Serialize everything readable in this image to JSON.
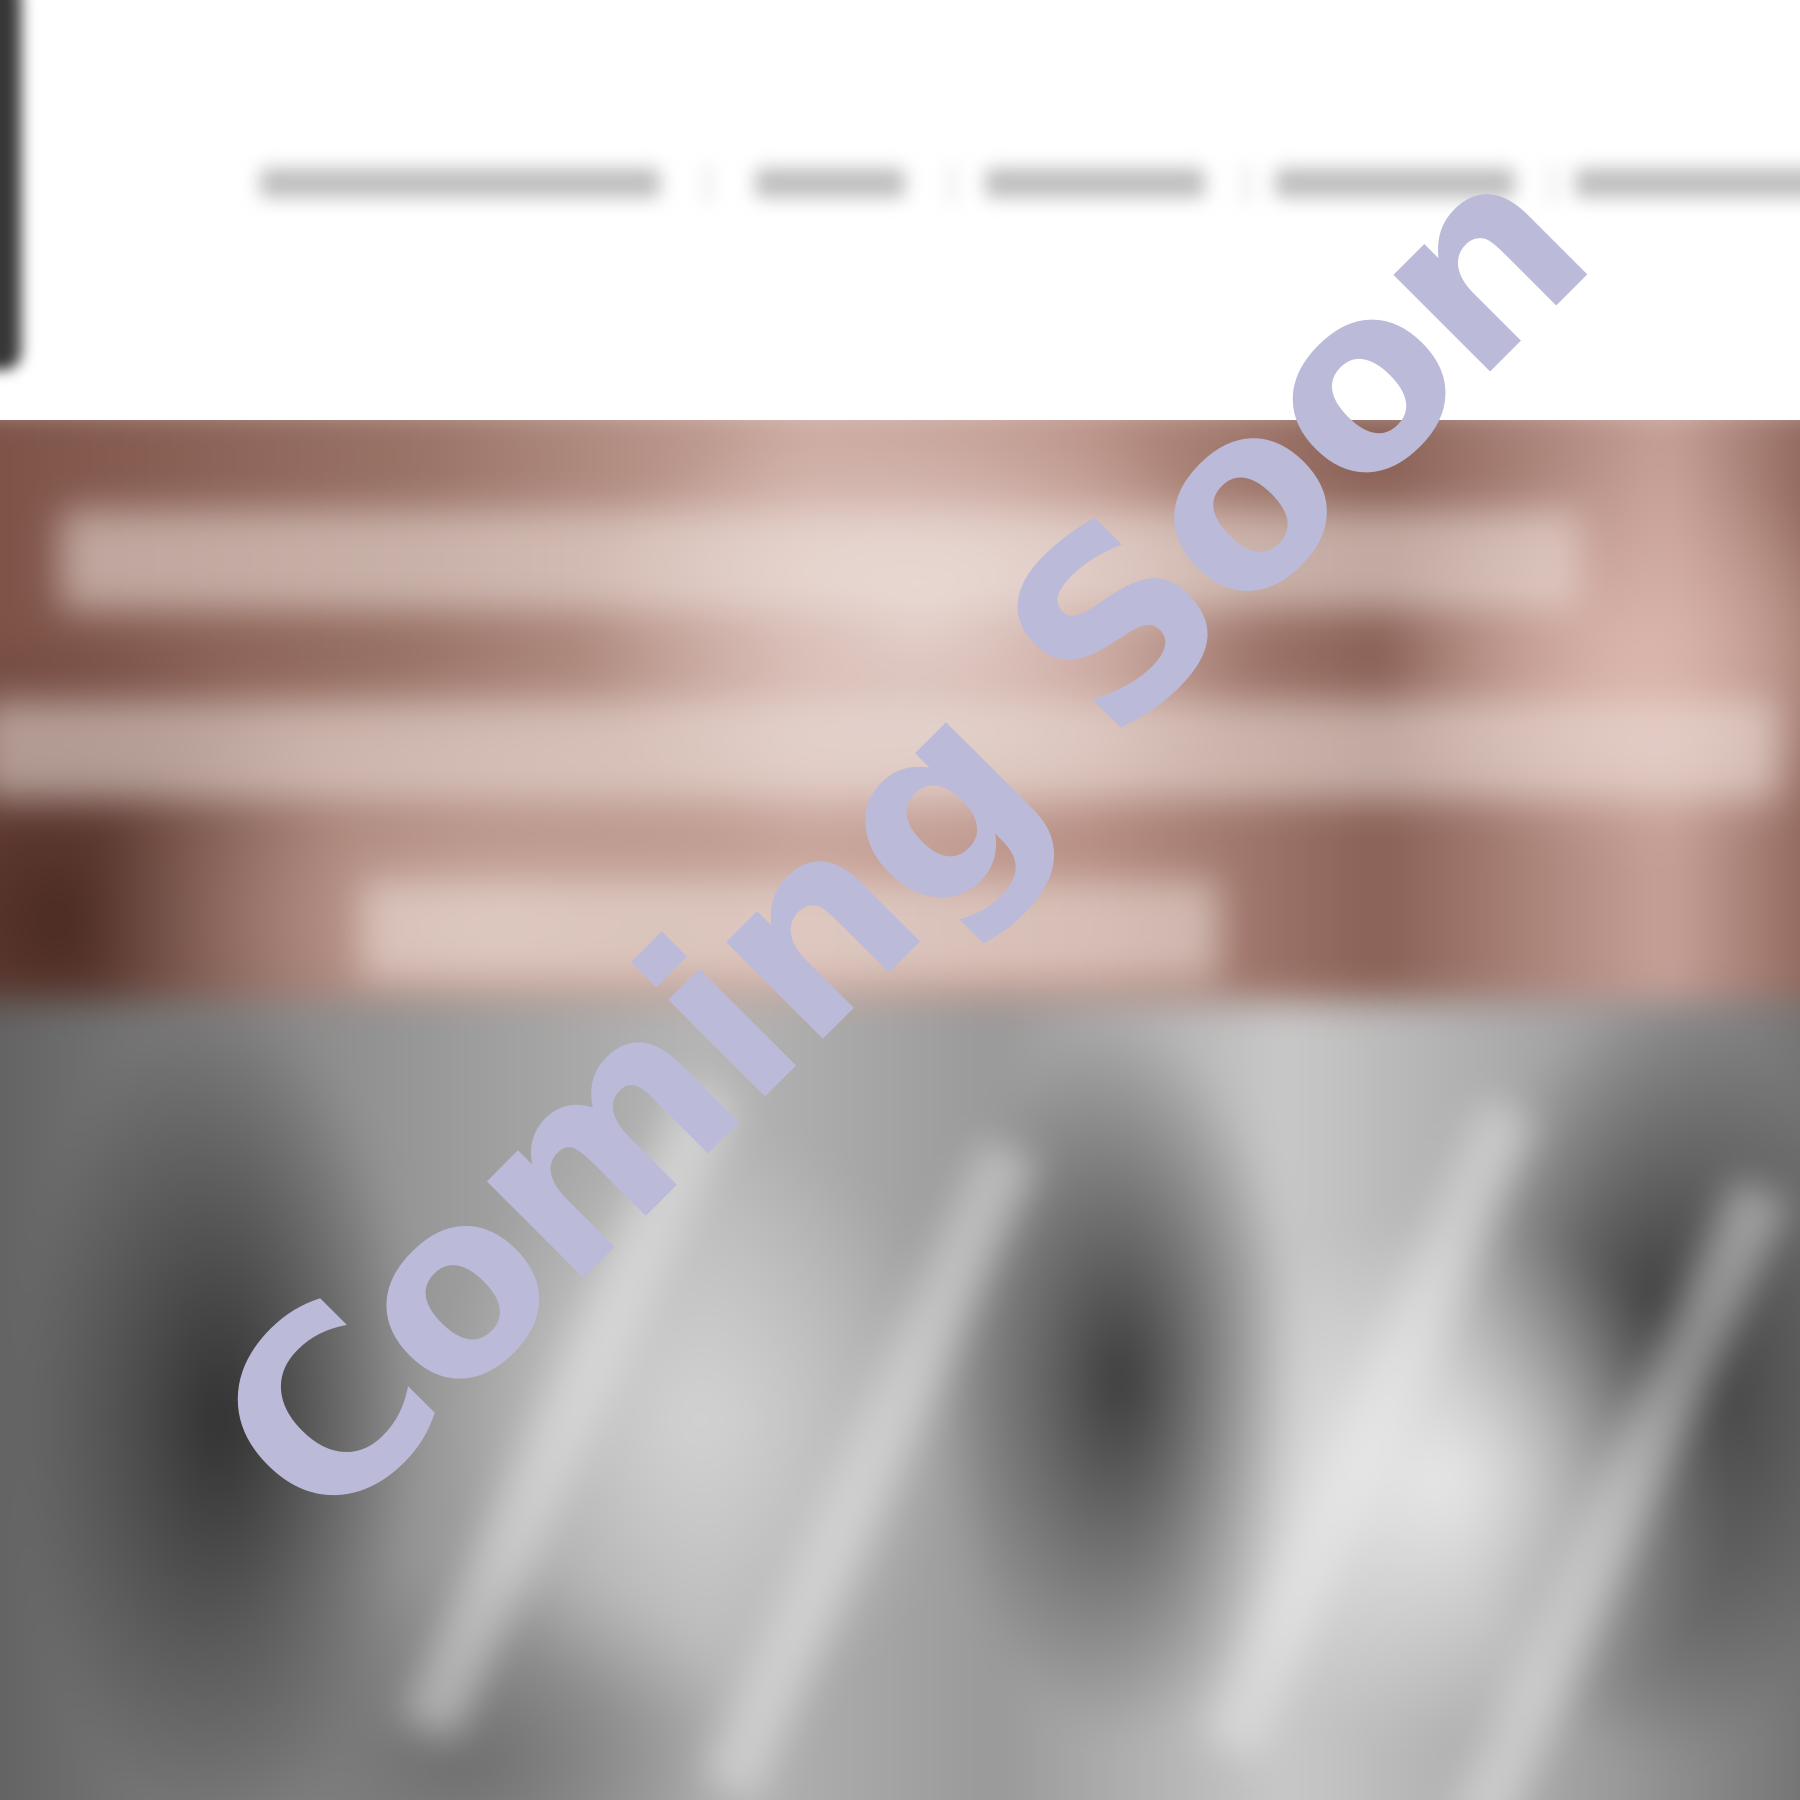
{
  "overlay": {
    "text": "Coming Soon",
    "color": "#bbbbd9"
  },
  "header": {
    "background": "#ffffff",
    "nav_item_count": 5
  },
  "hero": {
    "banner_tone": "#9b7468",
    "photo_tone": "#9a9a9a"
  }
}
